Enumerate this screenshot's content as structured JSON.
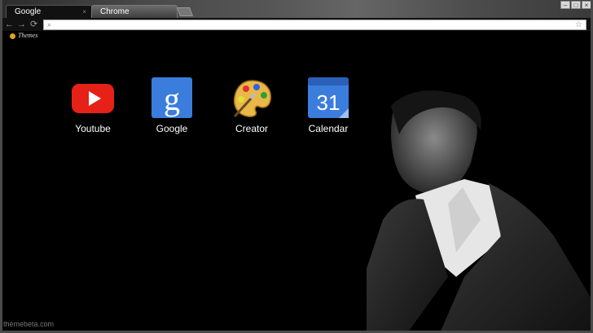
{
  "tabs": [
    {
      "label": "Google",
      "active": true
    },
    {
      "label": "Chrome",
      "active": false
    }
  ],
  "tab_close_glyph": "×",
  "window_controls": [
    "–",
    "□",
    "×"
  ],
  "toolbar": {
    "back_icon": "arrow-left-icon",
    "forward_icon": "arrow-right-icon",
    "reload_icon": "reload-icon",
    "omnibox_value": "",
    "star_icon": "star-icon"
  },
  "bookmarks": [
    {
      "label": "Themes"
    }
  ],
  "apps": [
    {
      "label": "Youtube",
      "icon": "youtube-icon",
      "color": "#e62117"
    },
    {
      "label": "Google",
      "icon": "google-icon",
      "color": "#3b7ddd"
    },
    {
      "label": "Creator",
      "icon": "palette-icon",
      "color": "#e0a020"
    },
    {
      "label": "Calendar",
      "icon": "calendar-icon",
      "color": "#3b7ddd",
      "day": "31"
    }
  ],
  "watermark": "themebeta.com"
}
